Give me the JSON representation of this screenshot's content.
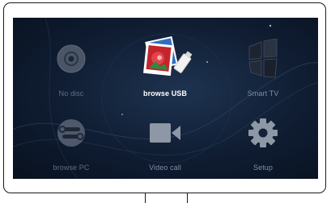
{
  "menu": {
    "items": [
      {
        "label": "No disc",
        "icon": "disc-icon",
        "state": "disabled"
      },
      {
        "label": "browse USB",
        "icon": "usb-photos-icon",
        "state": "selected"
      },
      {
        "label": "Smart TV",
        "icon": "smart-tv-window-icon",
        "state": "normal"
      },
      {
        "label": "browse PC",
        "icon": "network-pc-icon",
        "state": "disabled"
      },
      {
        "label": "Video call",
        "icon": "video-camera-icon",
        "state": "normal"
      },
      {
        "label": "Setup",
        "icon": "gear-icon",
        "state": "normal"
      }
    ]
  },
  "colors": {
    "screen_bg": "#0f1c31",
    "label_normal": "#7d8fa8",
    "label_selected": "#ffffff",
    "icon_gray": "#8a94a3"
  }
}
